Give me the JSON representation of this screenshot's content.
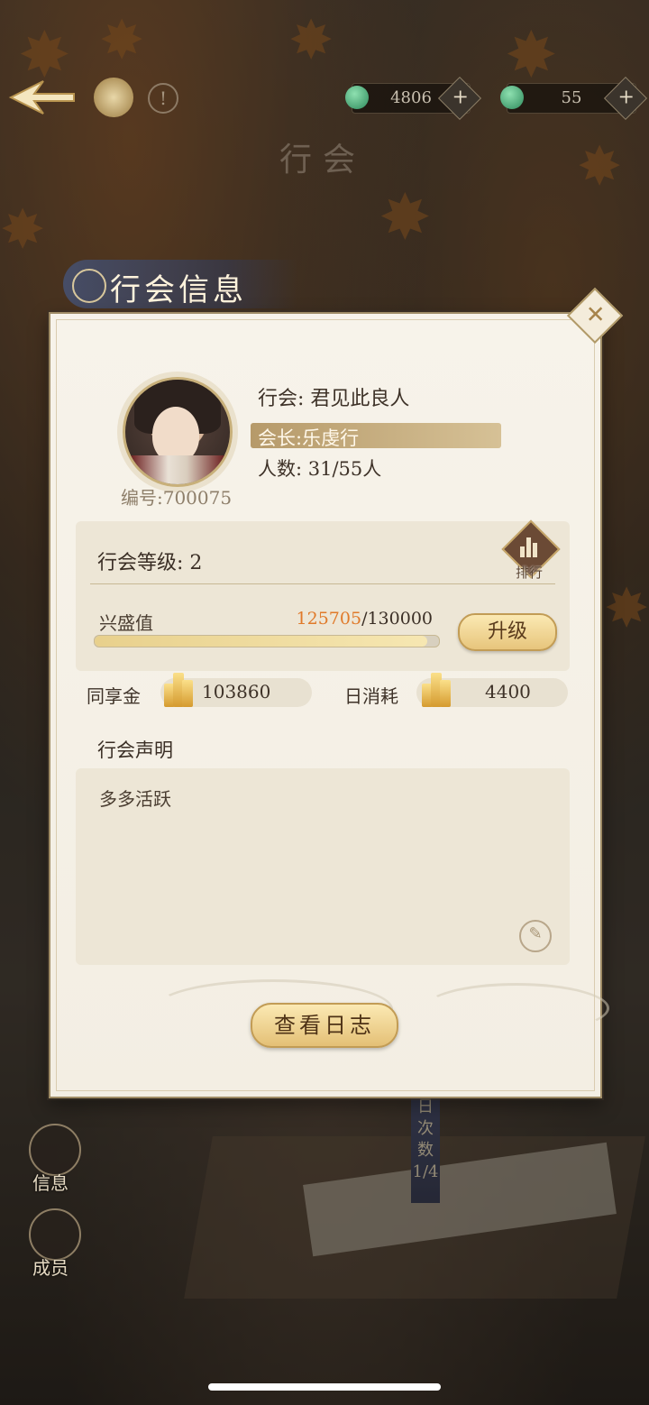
{
  "header": {
    "page_title": "行会",
    "resource_1": "4806",
    "resource_2": "55",
    "plus": "+"
  },
  "panel": {
    "title": "行会信息",
    "guild_name_line": "行会:  君见此良人",
    "leader_line": "会长:乐虔行",
    "members_line": "人数:  31/55人",
    "guild_id": "编号:700075",
    "level_line": "行会等级:  2",
    "rank_label": "排行",
    "prosperity_label": "兴盛值",
    "prosperity_current": "125705",
    "prosperity_max": "/130000",
    "prosperity_fraction": 0.967,
    "upgrade_label": "升级",
    "shared_gold_label": "同享金",
    "shared_gold_value": "103860",
    "daily_cost_label": "日消耗",
    "daily_cost_value": "4400",
    "declaration_title": "行会声明",
    "declaration_text": "多多活跃",
    "view_log_label": "查看日志"
  },
  "side_nav": {
    "info_label": "信息",
    "members_label": "成员"
  },
  "background": {
    "daily_text": "日次数1/4"
  },
  "colors": {
    "accent_orange": "#e07a2a",
    "panel_bg": "#f5f0e6",
    "gold_button": "#e7c57c"
  }
}
